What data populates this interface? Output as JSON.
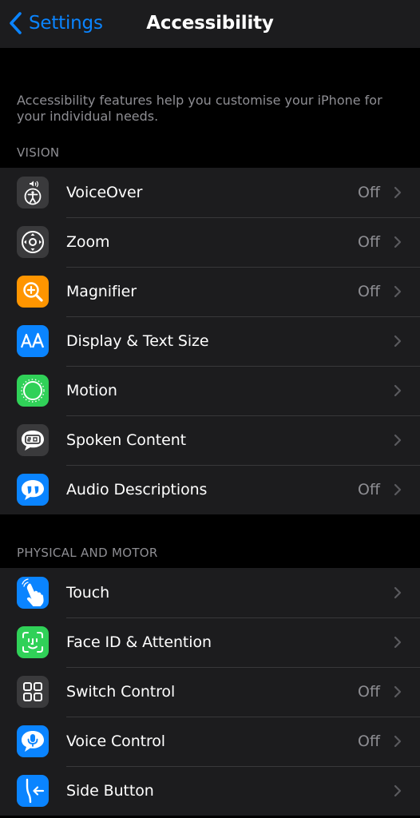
{
  "nav": {
    "back_label": "Settings",
    "title": "Accessibility"
  },
  "intro_text": "Accessibility features help you customise your iPhone for your individual needs.",
  "sections": [
    {
      "header": "VISION",
      "items": [
        {
          "label": "VoiceOver",
          "value": "Off",
          "icon": "voiceover-icon",
          "color": "#3a3a3c"
        },
        {
          "label": "Zoom",
          "value": "Off",
          "icon": "zoom-icon",
          "color": "#3a3a3c"
        },
        {
          "label": "Magnifier",
          "value": "Off",
          "icon": "magnifier-icon",
          "color": "#ff9500"
        },
        {
          "label": "Display & Text Size",
          "value": "",
          "icon": "display-text-size-icon",
          "color": "#0a84ff"
        },
        {
          "label": "Motion",
          "value": "",
          "icon": "motion-icon",
          "color": "#30d158"
        },
        {
          "label": "Spoken Content",
          "value": "",
          "icon": "spoken-content-icon",
          "color": "#3a3a3c"
        },
        {
          "label": "Audio Descriptions",
          "value": "Off",
          "icon": "audio-descriptions-icon",
          "color": "#0a84ff"
        }
      ]
    },
    {
      "header": "PHYSICAL AND MOTOR",
      "items": [
        {
          "label": "Touch",
          "value": "",
          "icon": "touch-icon",
          "color": "#0a84ff"
        },
        {
          "label": "Face ID & Attention",
          "value": "",
          "icon": "face-id-icon",
          "color": "#30d158"
        },
        {
          "label": "Switch Control",
          "value": "Off",
          "icon": "switch-control-icon",
          "color": "#3a3a3c"
        },
        {
          "label": "Voice Control",
          "value": "Off",
          "icon": "voice-control-icon",
          "color": "#0a84ff"
        },
        {
          "label": "Side Button",
          "value": "",
          "icon": "side-button-icon",
          "color": "#0a84ff"
        }
      ]
    }
  ],
  "colors": {
    "accent": "#0a84ff",
    "background": "#000000",
    "cell": "#1c1c1e",
    "secondary_text": "#8e8e93"
  }
}
